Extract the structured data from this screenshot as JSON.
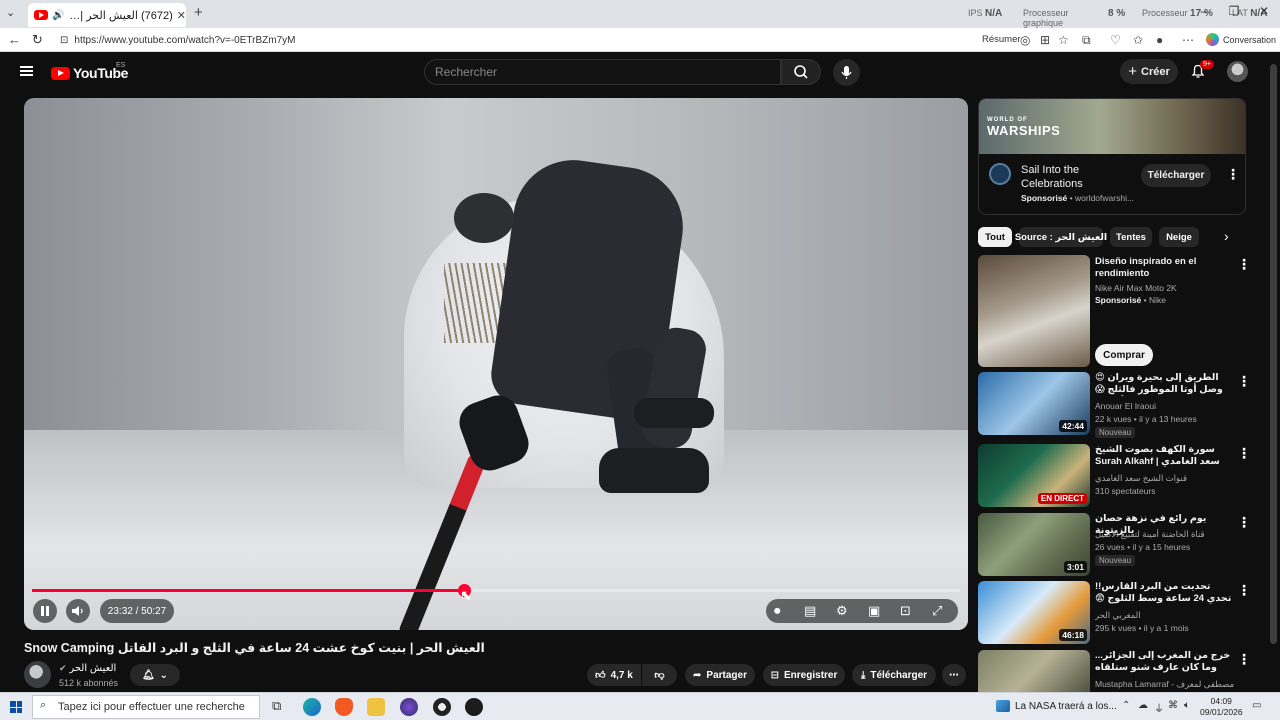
{
  "browser": {
    "tab_title": "(7672) العيش الحر | بنيت كوخ ...",
    "url": "https://www.youtube.com/watch?v=-0ETrBZm7yM",
    "perf": {
      "ips_label": "IPS",
      "ips_value": "N/A",
      "gpu_label": "Processeur graphique",
      "gpu_value": "8 %",
      "cpu_label": "Processeur",
      "cpu_value": "17 %",
      "lat_label": "LAT",
      "lat_value": "N/A"
    },
    "resume_label": "Résumer",
    "conversation_label": "Conversation"
  },
  "youtube": {
    "logo_text": "YouTube",
    "region": "ES",
    "search_placeholder": "Rechercher",
    "create_label": "Créer",
    "notif_badge": "9+"
  },
  "player": {
    "current_time": "23:32",
    "duration": "50:27",
    "time_display": "23:32 / 50:27",
    "progress_fraction": 0.466
  },
  "video": {
    "title": "العيش الحر | بنيت كوخ عشت 24 ساعة في الثلج و البرد القاتل Snow Camping",
    "channel_name": "العيش الحر",
    "subscribers": "512 k abonnés",
    "likes": "4,7 k",
    "share_label": "Partager",
    "save_label": "Enregistrer",
    "download_label": "Télécharger"
  },
  "ad": {
    "brand_small": "WORLD OF",
    "brand": "WARSHIPS",
    "title": "Sail Into the Celebrations",
    "sponsored": "Sponsorisé",
    "advertiser": "worldofwarshi...",
    "download_label": "Télécharger"
  },
  "chips": [
    "Tout",
    "Source : العيش الحر",
    "Tentes",
    "Neige"
  ],
  "sponsored_rec": {
    "title": "Diseño inspirado en el rendimiento",
    "subtitle": "Nike Air Max Moto 2K",
    "sponsored": "Sponsorisé",
    "advertiser": "Nike",
    "buy_label": "Comprar"
  },
  "recommendations": [
    {
      "title": "الطريق إلى بحيرة ويران 😍 وصل أوتا الموطور فالثلج 😱 مغامرة في جبال الأطلس",
      "channel": "Anouar El Iraoui",
      "meta": "22 k vues • il y a 13 heures",
      "badge": "Nouveau",
      "duration": "42:44"
    },
    {
      "title": "سورة الكهف بصوت الشيخ سعد الغامدي | Surah Alkahf",
      "channel": "قنوات الشيخ سعد الغامدي",
      "meta": "310 spectateurs",
      "badge": "",
      "duration": "EN DIRECT"
    },
    {
      "title": "يوم رائع في نزهة حصان بالزيتونة",
      "channel": "قناة الحاضنة أمينة لتقبيع الأصيل",
      "meta": "26 vues • il y a 15 heures",
      "badge": "Nouveau",
      "duration": "3:01"
    },
    {
      "title": "تحديت من البرد القارس!! تحدي 24 ساعة وسط الثلوج 😨",
      "channel": "المغربي الحر",
      "meta": "295 k vues • il y a 1 mois",
      "badge": "",
      "duration": "46:18"
    },
    {
      "title": "خرج من المغرب إلى الجزائر... وما كان عارف شنو ستلقاه",
      "channel": "Mustapha Lamarraf - مصطفى لمعرف",
      "meta": "",
      "badge": "",
      "duration": ""
    }
  ],
  "taskbar": {
    "search_placeholder": "Tapez ici pour effectuer une recherche",
    "news": "La NASA traerá a los...",
    "time": "04:09",
    "date": "09/01/2026"
  },
  "colors": {
    "accent_red": "#ff0033",
    "youtube_red": "#ff0000",
    "background": "#0f0f0f"
  }
}
